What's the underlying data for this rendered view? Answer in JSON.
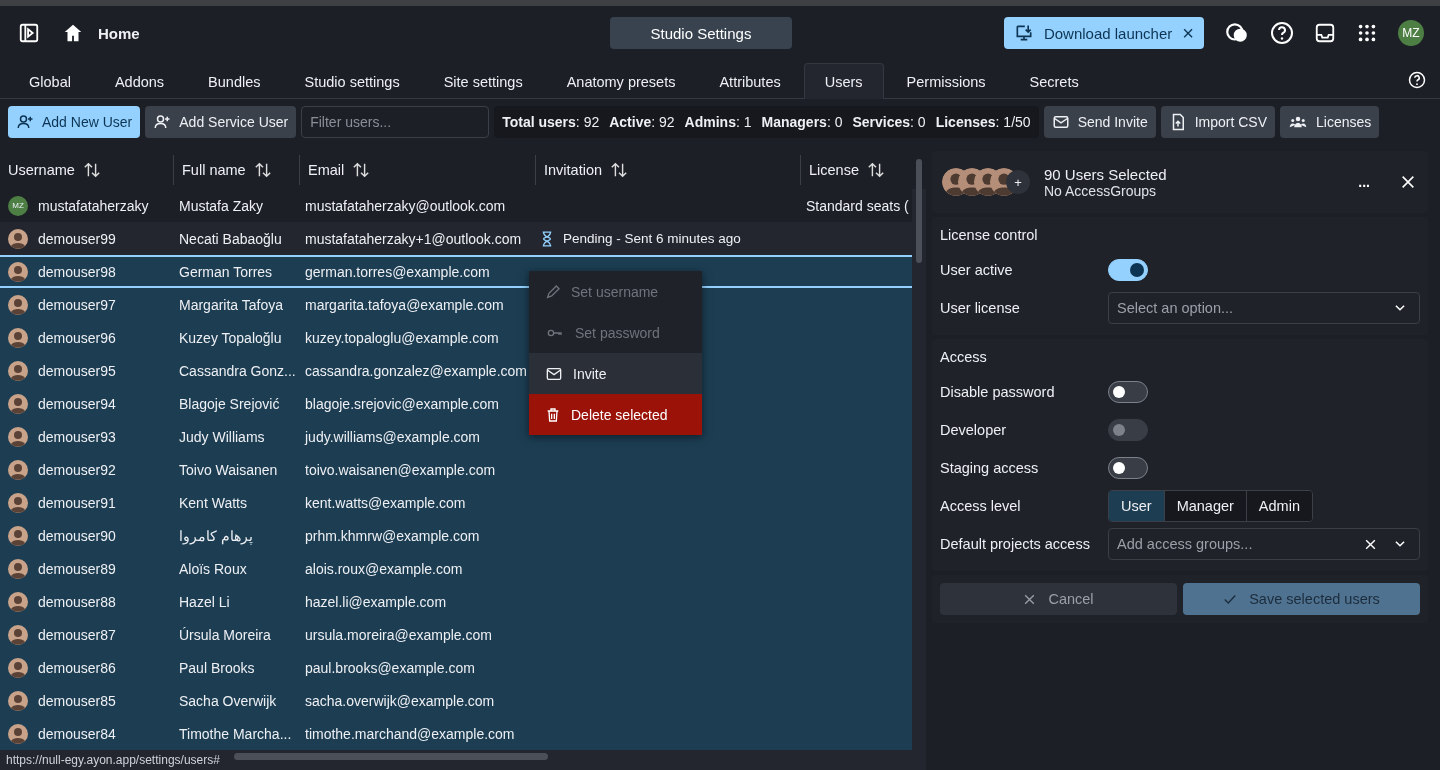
{
  "header": {
    "home_label": "Home",
    "center_button": "Studio Settings",
    "download": {
      "label": "Download launcher",
      "close": "×"
    },
    "user_initials": "MZ"
  },
  "tabs": [
    {
      "label": "Global",
      "selected": false
    },
    {
      "label": "Addons",
      "selected": false
    },
    {
      "label": "Bundles",
      "selected": false
    },
    {
      "label": "Studio settings",
      "selected": false
    },
    {
      "label": "Site settings",
      "selected": false
    },
    {
      "label": "Anatomy presets",
      "selected": false
    },
    {
      "label": "Attributes",
      "selected": false
    },
    {
      "label": "Users",
      "selected": true
    },
    {
      "label": "Permissions",
      "selected": false
    },
    {
      "label": "Secrets",
      "selected": false
    }
  ],
  "toolbar": {
    "add_user": "Add New User",
    "add_service": "Add Service User",
    "filter": {
      "placeholder": "Filter users..."
    },
    "stats": [
      "**Total users**: 92",
      "**Active**: 92",
      "**Admins**: 1",
      "**Managers**: 0",
      "**Services**: 0",
      "**Licenses**: 1/50"
    ],
    "send_invite": "Send Invite",
    "import_csv": "Import CSV",
    "licenses": "Licenses"
  },
  "table": {
    "columns": [
      "Username",
      "Full name",
      "Email",
      "Invitation",
      "License"
    ],
    "rows": [
      {
        "avatar": {
          "kind": "initials",
          "text": "MZ"
        },
        "username": "mustafataherzaky",
        "full_name": "Mustafa Zaky",
        "email": "mustafataherzaky@outlook.com",
        "invitation": "",
        "license": "Standard seats (",
        "selected": false,
        "focused": false
      },
      {
        "avatar": {
          "kind": "photo"
        },
        "username": "demouser99",
        "full_name": "Necati Babaoğlu",
        "email": "mustafataherzaky+1@outlook.com",
        "invitation": "Pending - Sent 6 minutes ago",
        "selected": false,
        "focused": false
      },
      {
        "avatar": {
          "kind": "photo"
        },
        "username": "demouser98",
        "full_name": "German Torres",
        "email": "german.torres@example.com",
        "selected": true,
        "focused": true
      },
      {
        "avatar": {
          "kind": "photo"
        },
        "username": "demouser97",
        "full_name": "Margarita Tafoya",
        "email": "margarita.tafoya@example.com",
        "selected": true,
        "focused": false
      },
      {
        "avatar": {
          "kind": "photo"
        },
        "username": "demouser96",
        "full_name": "Kuzey Topaloğlu",
        "email": "kuzey.topaloglu@example.com",
        "selected": true,
        "focused": false
      },
      {
        "avatar": {
          "kind": "photo"
        },
        "username": "demouser95",
        "full_name": "Cassandra Gonz...",
        "email": "cassandra.gonzalez@example.com",
        "selected": true,
        "focused": false
      },
      {
        "avatar": {
          "kind": "photo"
        },
        "username": "demouser94",
        "full_name": "Blagoje Srejović",
        "email": "blagoje.srejovic@example.com",
        "selected": true,
        "focused": false
      },
      {
        "avatar": {
          "kind": "photo"
        },
        "username": "demouser93",
        "full_name": "Judy Williams",
        "email": "judy.williams@example.com",
        "selected": true,
        "focused": false
      },
      {
        "avatar": {
          "kind": "photo"
        },
        "username": "demouser92",
        "full_name": "Toivo Waisanen",
        "email": "toivo.waisanen@example.com",
        "selected": true,
        "focused": false
      },
      {
        "avatar": {
          "kind": "photo"
        },
        "username": "demouser91",
        "full_name": "Kent Watts",
        "email": "kent.watts@example.com",
        "selected": true,
        "focused": false
      },
      {
        "avatar": {
          "kind": "photo"
        },
        "username": "demouser90",
        "full_name": "پرهام کامروا",
        "email": "prhm.khmrw@example.com",
        "selected": true,
        "focused": false
      },
      {
        "avatar": {
          "kind": "photo"
        },
        "username": "demouser89",
        "full_name": "Aloïs Roux",
        "email": "alois.roux@example.com",
        "selected": true,
        "focused": false
      },
      {
        "avatar": {
          "kind": "photo"
        },
        "username": "demouser88",
        "full_name": "Hazel Li",
        "email": "hazel.li@example.com",
        "selected": true,
        "focused": false
      },
      {
        "avatar": {
          "kind": "photo"
        },
        "username": "demouser87",
        "full_name": "Úrsula Moreira",
        "email": "ursula.moreira@example.com",
        "selected": true,
        "focused": false
      },
      {
        "avatar": {
          "kind": "photo"
        },
        "username": "demouser86",
        "full_name": "Paul Brooks",
        "email": "paul.brooks@example.com",
        "selected": true,
        "focused": false
      },
      {
        "avatar": {
          "kind": "photo"
        },
        "username": "demouser85",
        "full_name": "Sacha Overwijk",
        "email": "sacha.overwijk@example.com",
        "selected": true,
        "focused": false
      },
      {
        "avatar": {
          "kind": "photo"
        },
        "username": "demouser84",
        "full_name": "Timothe Marcha...",
        "email": "timothe.marchand@example.com",
        "selected": true,
        "focused": false
      }
    ]
  },
  "context_menu": [
    {
      "kind": "edit",
      "label": "Set username",
      "disabled": true,
      "hovered": false
    },
    {
      "kind": "key",
      "label": "Set password",
      "disabled": true,
      "hovered": false
    },
    {
      "kind": "mail",
      "label": "Invite",
      "disabled": false,
      "hovered": true
    },
    {
      "kind": "delete",
      "label": "Delete selected",
      "disabled": false,
      "hovered": false
    }
  ],
  "panel": {
    "more_label": "+",
    "title": "90 Users Selected",
    "subtitle": "No AccessGroups",
    "more": "...",
    "license_section": {
      "title": "License control",
      "rows": [
        {
          "kind": "toggle",
          "label": "User active",
          "on": true,
          "disabled": false
        },
        {
          "kind": "select",
          "label": "User license",
          "placeholder": "Select an option..."
        }
      ]
    },
    "access_section": {
      "title": "Access",
      "rows": [
        {
          "kind": "toggle",
          "label": "Disable password",
          "on": false,
          "disabled": false
        },
        {
          "kind": "toggle",
          "label": "Developer",
          "on": false,
          "disabled": true
        },
        {
          "kind": "toggle",
          "label": "Staging access",
          "on": false,
          "disabled": false
        },
        {
          "kind": "segments",
          "label": "Access level",
          "options": [
            {
              "label": "User",
              "selected": true
            },
            {
              "label": "Manager",
              "selected": false
            },
            {
              "label": "Admin",
              "selected": false
            }
          ]
        },
        {
          "kind": "multiselect",
          "label": "Default projects access",
          "placeholder": "Add access groups..."
        }
      ]
    },
    "cancel": "Cancel",
    "save": "Save selected users"
  },
  "status_url": "https://null-egy.ayon.app/settings/users#"
}
